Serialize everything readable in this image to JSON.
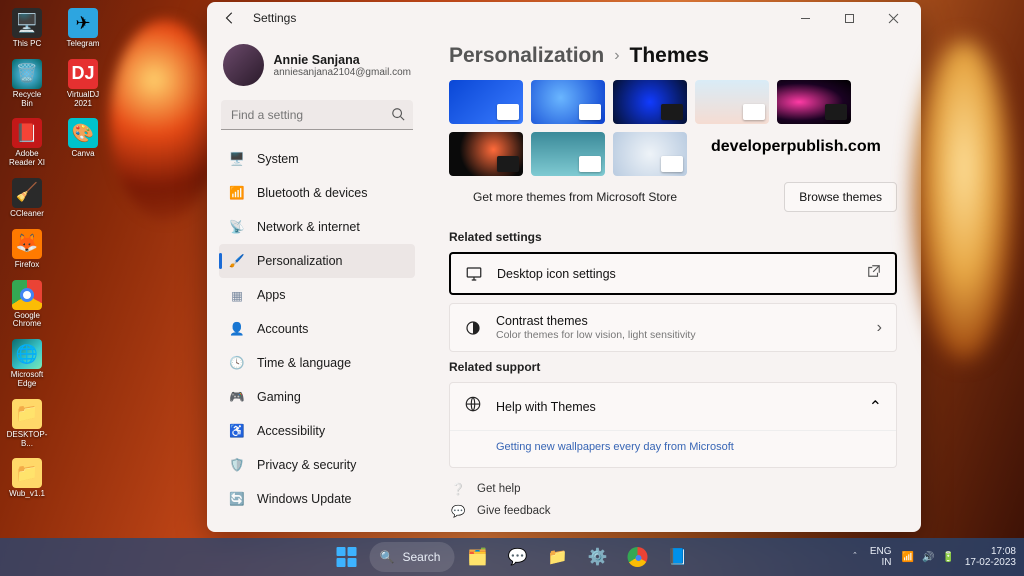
{
  "desktop_icons": [
    [
      {
        "label": "This PC"
      },
      {
        "label": "Telegram"
      }
    ],
    [
      {
        "label": "Recycle Bin"
      },
      {
        "label": "VirtualDJ 2021"
      }
    ],
    [
      {
        "label": "Adobe Reader XI"
      },
      {
        "label": "Canva"
      }
    ],
    [
      {
        "label": "CCleaner"
      }
    ],
    [
      {
        "label": "Firefox"
      }
    ],
    [
      {
        "label": "Google Chrome"
      }
    ],
    [
      {
        "label": "Microsoft Edge"
      }
    ],
    [
      {
        "label": "DESKTOP-B..."
      }
    ],
    [
      {
        "label": "Wub_v1.1"
      }
    ]
  ],
  "window": {
    "title": "Settings"
  },
  "profile": {
    "name": "Annie Sanjana",
    "email": "anniesanjana2104@gmail.com"
  },
  "search": {
    "placeholder": "Find a setting"
  },
  "nav": {
    "items": [
      {
        "label": "System"
      },
      {
        "label": "Bluetooth & devices"
      },
      {
        "label": "Network & internet"
      },
      {
        "label": "Personalization",
        "selected": true
      },
      {
        "label": "Apps"
      },
      {
        "label": "Accounts"
      },
      {
        "label": "Time & language"
      },
      {
        "label": "Gaming"
      },
      {
        "label": "Accessibility"
      },
      {
        "label": "Privacy & security"
      },
      {
        "label": "Windows Update"
      }
    ]
  },
  "breadcrumb": {
    "parent": "Personalization",
    "current": "Themes"
  },
  "watermark": "developerpublish.com",
  "store": {
    "text": "Get more themes from Microsoft Store",
    "button": "Browse themes"
  },
  "sections": {
    "related_settings": "Related settings",
    "related_support": "Related support"
  },
  "cards": {
    "desktop_icon": {
      "title": "Desktop icon settings"
    },
    "contrast": {
      "title": "Contrast themes",
      "sub": "Color themes for low vision, light sensitivity"
    },
    "help_themes": {
      "title": "Help with Themes"
    },
    "wallpapers": "Getting new wallpapers every day from Microsoft"
  },
  "links": {
    "get_help": "Get help",
    "feedback": "Give feedback"
  },
  "taskbar": {
    "search": "Search",
    "lang1": "ENG",
    "lang2": "IN",
    "time": "17:08",
    "date": "17-02-2023"
  }
}
